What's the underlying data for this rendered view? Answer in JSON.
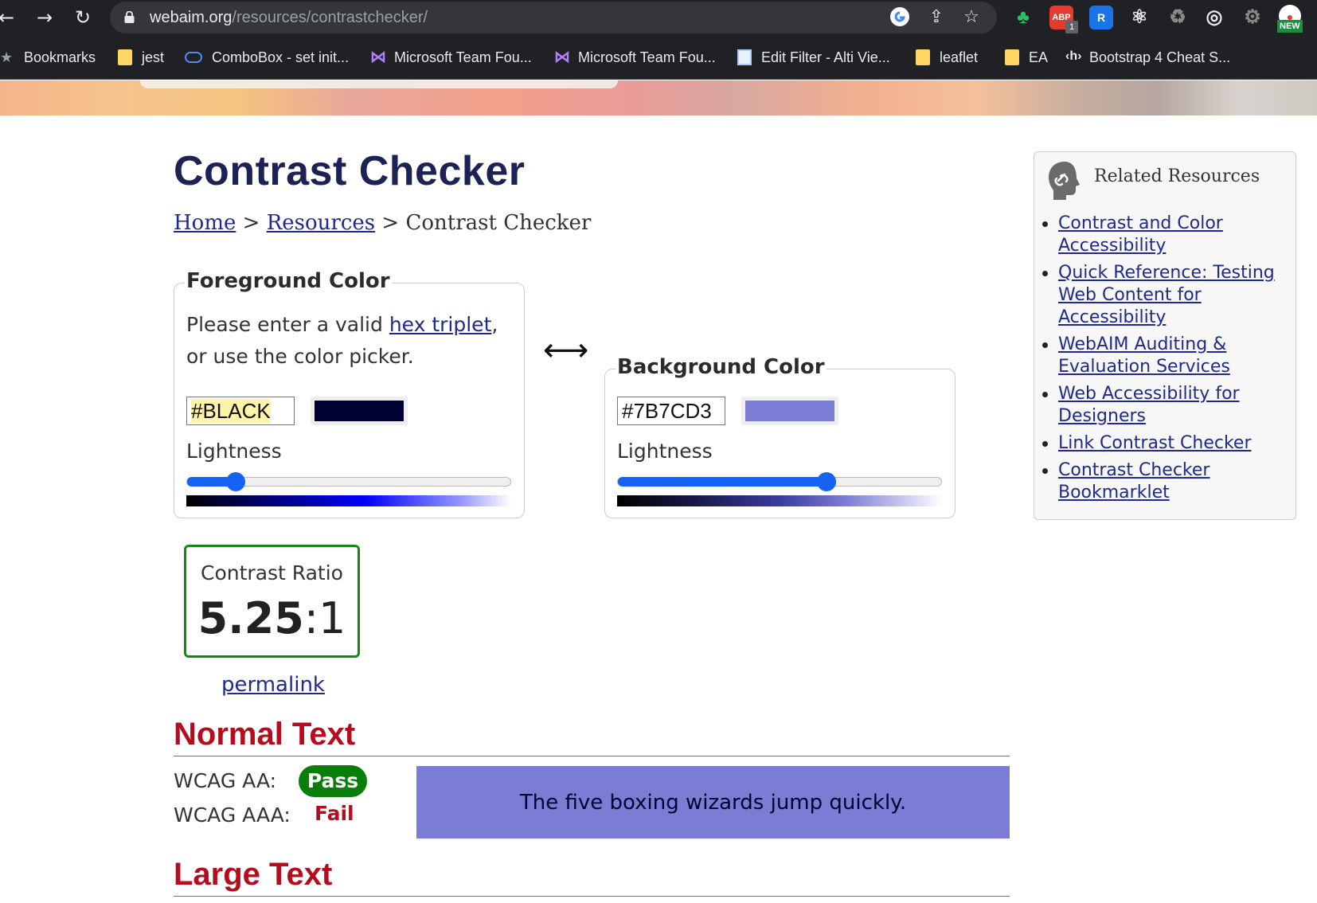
{
  "browser": {
    "url_host": "webaim.org",
    "url_path": "/resources/contrastchecker/",
    "new_badge": "NEW",
    "abp_label": "ABP",
    "abp_count": "1",
    "r_ext_label": "R",
    "bookmarks": [
      {
        "label": "Bookmarks",
        "icon": "star-icon"
      },
      {
        "label": "jest",
        "icon": "folder-icon"
      },
      {
        "label": "ComboBox - set init...",
        "icon": "cloud-icon"
      },
      {
        "label": "Microsoft Team Fou...",
        "icon": "visual-studio-icon"
      },
      {
        "label": "Microsoft Team Fou...",
        "icon": "visual-studio-icon"
      },
      {
        "label": "Edit Filter - Alti Vie...",
        "icon": "document-icon"
      },
      {
        "label": "leaflet",
        "icon": "folder-icon"
      },
      {
        "label": "EA",
        "icon": "folder-icon"
      },
      {
        "label": "Bootstrap 4 Cheat S...",
        "icon": "h-icon"
      }
    ]
  },
  "page": {
    "title": "Contrast Checker",
    "breadcrumb": {
      "home": "Home",
      "sep1": " > ",
      "resources": "Resources",
      "sep2": " > ",
      "current": "Contrast Checker"
    }
  },
  "foreground": {
    "legend": "Foreground Color",
    "instr_before": "Please enter a valid ",
    "instr_link": "hex triplet",
    "instr_after": ", or use the color picker.",
    "value": "#BLACK",
    "swatch_color": "#000033",
    "lightness_label": "Lightness",
    "lightness_fraction": 0.15
  },
  "background": {
    "legend": "Background Color",
    "value": "#7B7CD3",
    "swatch_color": "#7B7CD3",
    "lightness_label": "Lightness",
    "lightness_fraction": 0.645
  },
  "swap_symbol": "⟷",
  "result": {
    "label": "Contrast Ratio",
    "ratio_main": "5.25",
    "ratio_suffix": ":1",
    "permalink": "permalink"
  },
  "normal_text": {
    "heading": "Normal Text",
    "aa_label": "WCAG AA:",
    "aa_result": "Pass",
    "aaa_label": "WCAG AAA:",
    "aaa_result": "Fail",
    "sample": "The five boxing wizards jump quickly."
  },
  "large_text": {
    "heading": "Large Text"
  },
  "sidebar": {
    "title": "Related Resources",
    "links": [
      "Contrast and Color Accessibility",
      "Quick Reference: Testing Web Content for Accessibility",
      "WebAIM Auditing & Evaluation Services",
      "Web Accessibility for Designers",
      "Link Contrast Checker",
      "Contrast Checker Bookmarklet"
    ]
  },
  "colors": {
    "pass_green": "#0A7E0A",
    "fail_red": "#B50D1E",
    "link_blue": "#1F2A8C",
    "slider_blue": "#1463F3"
  }
}
